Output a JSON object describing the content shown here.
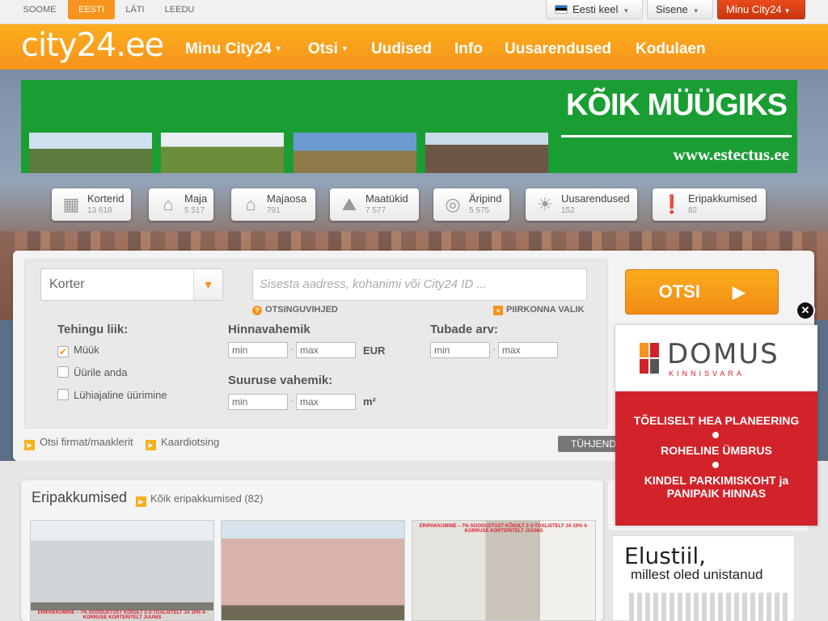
{
  "topbar": {
    "languages": [
      "SOOME",
      "EESTI",
      "LÄTI",
      "LEEDU"
    ],
    "active_language": "EESTI",
    "lang_button": "Eesti keel",
    "login_button": "Sisene",
    "account_button": "Minu City24"
  },
  "header": {
    "logo": "city24.ee",
    "nav": [
      "Minu City24",
      "Otsi",
      "Uudised",
      "Info",
      "Uusarendused",
      "Kodulaen"
    ]
  },
  "ad_banner": {
    "title": "KÕIK MÜÜGIKS",
    "url": "www.estectus.ee",
    "brand_color": "#1a9e34"
  },
  "categories": [
    {
      "label": "Korterid",
      "count": "13 618",
      "icon": "apartment-icon"
    },
    {
      "label": "Maja",
      "count": "5 517",
      "icon": "house-icon"
    },
    {
      "label": "Majaosa",
      "count": "791",
      "icon": "house-part-icon"
    },
    {
      "label": "Maatükid",
      "count": "7 577",
      "icon": "land-icon"
    },
    {
      "label": "Äripind",
      "count": "5 575",
      "icon": "commercial-icon"
    },
    {
      "label": "Uusarendused",
      "count": "152",
      "icon": "sun-icon"
    },
    {
      "label": "Eripakkumised",
      "count": "82",
      "icon": "exclamation-icon"
    }
  ],
  "search": {
    "property_type": "Korter",
    "address_placeholder": "Sisesta aadress, kohanimi või City24 ID ...",
    "tips_link": "OTSINGUVIHJED",
    "area_link": "PIIRKONNA VALIK",
    "deal_type_label": "Tehingu liik:",
    "deal_types": [
      {
        "label": "Müük",
        "checked": true
      },
      {
        "label": "Üürile anda",
        "checked": false
      },
      {
        "label": "Lühiajaline üürimine",
        "checked": false
      }
    ],
    "price_label": "Hinnavahemik",
    "size_label": "Suuruse vahemik:",
    "rooms_label": "Tubade arv:",
    "min_placeholder": "min",
    "max_placeholder": "max",
    "range_separator": "-",
    "currency": "EUR",
    "area_unit": "m²",
    "submit": "OTSI",
    "firm_link": "Otsi firmat/maaklerit",
    "map_link": "Kaardiotsing",
    "clear_button": "TÜHJEND"
  },
  "offers": {
    "title": "Eripakkumised",
    "all_link": "Kõik eripakkumised (82)",
    "photo_caption": "ERIPAKKUMINE – 7% SOODUSTUST KÕIGILT 2-3-TOALISTELT JA 10% 4-KORRUSE KORTERITELT JUUNIS"
  },
  "domus_ad": {
    "name": "DOMUS",
    "subtitle": "KINNISVARA",
    "lines": [
      "TÕELISELT HEA PLANEERING",
      "ROHELINE ÜMBRUS",
      "KINDEL PARKIMISKOHT ja PANIPAIK HINNAS"
    ],
    "close": "✕"
  },
  "elustiil_ad": {
    "title": "Elustiil,",
    "subtitle": "millest oled unistanud"
  }
}
